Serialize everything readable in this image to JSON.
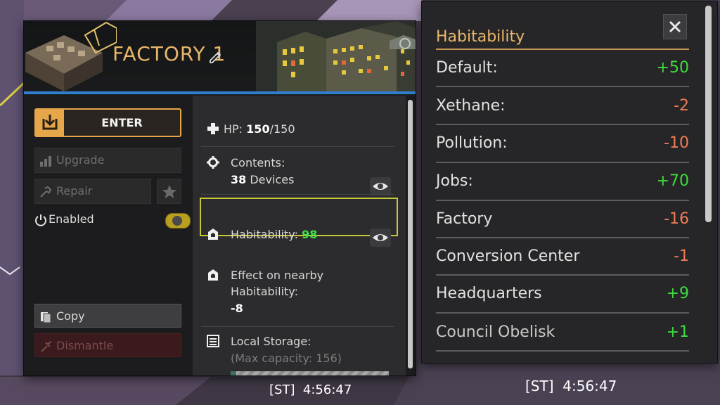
{
  "building": {
    "title": "FACTORY 1",
    "enter_label": "ENTER",
    "upgrade_label": "Upgrade",
    "repair_label": "Repair",
    "enabled_label": "Enabled",
    "enabled": true,
    "copy_label": "Copy",
    "dismantle_label": "Dismantle"
  },
  "info": {
    "hp_label": "HP:",
    "hp_current": "150",
    "hp_max": "/150",
    "contents_label": "Contents:",
    "contents_count": "38",
    "contents_unit": "Devices",
    "habitability_label": "Habitability:",
    "habitability_value": "98",
    "effect_label_1": "Effect on nearby",
    "effect_label_2": "Habitability:",
    "effect_value": "-8",
    "storage_label": "Local Storage:",
    "storage_capacity": "(Max capacity: 156)"
  },
  "habitability_panel": {
    "title": "Habitability",
    "close_icon": "close-icon",
    "rows": [
      {
        "label": "Default:",
        "value": "+50"
      },
      {
        "label": "Xethane:",
        "value": "-2"
      },
      {
        "label": "Pollution:",
        "value": "-10"
      },
      {
        "label": "Jobs:",
        "value": "+70"
      },
      {
        "label": "Factory",
        "value": "-16"
      },
      {
        "label": "Conversion Center",
        "value": "-1"
      },
      {
        "label": "Headquarters",
        "value": "+9"
      },
      {
        "label": "Council Obelisk",
        "value": "+1"
      }
    ]
  },
  "clock": {
    "left": "[ST]  4:56:47",
    "right": "[ST]  4:56:47"
  },
  "colors": {
    "accent": "#e6a74a",
    "positive": "#3fdb3f",
    "negative": "#ef7b55",
    "highlight": "#c8c83a",
    "header_bar": "#2f7fd1"
  }
}
